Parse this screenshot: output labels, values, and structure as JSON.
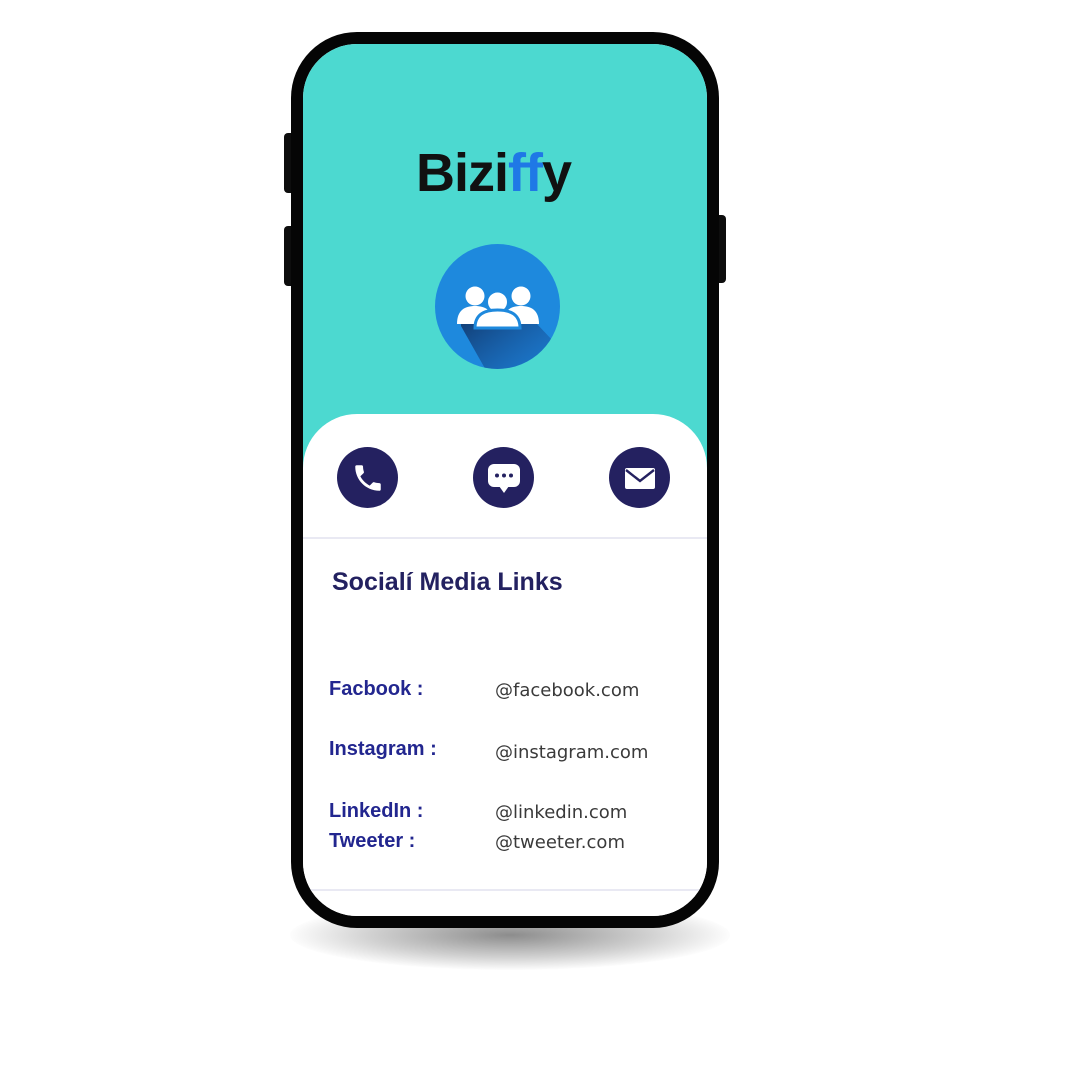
{
  "app": {
    "brand_prefix": "Bizi",
    "brand_highlight": "ff",
    "brand_suffix": "y"
  },
  "header": {
    "avatar_icon": "group-people-icon"
  },
  "actions": [
    {
      "icon": "phone-icon"
    },
    {
      "icon": "message-icon"
    },
    {
      "icon": "mail-icon"
    }
  ],
  "social": {
    "title": "Socialí Media Links",
    "rows": [
      {
        "label": "Facbook :",
        "value": "@facebook.com"
      },
      {
        "label": "Instagram :",
        "value": "@instagram.com"
      },
      {
        "label": "LinkedIn :",
        "value": "@linkedin.com"
      },
      {
        "label": "Tweeter :",
        "value": "@tweeter.com"
      }
    ]
  },
  "colors": {
    "teal": "#4cd9d0",
    "brand_blue": "#1f78e6",
    "navy": "#242160",
    "label_blue": "#22268f"
  }
}
